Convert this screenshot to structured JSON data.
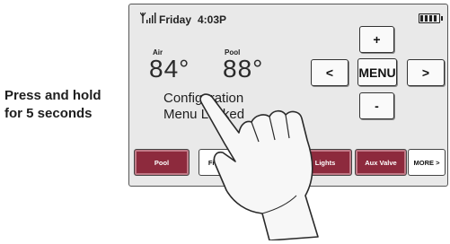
{
  "caption": {
    "line1": "Press and hold",
    "line2": "for 5 seconds"
  },
  "status": {
    "day": "Friday",
    "time": "4:03P",
    "signal_icon": "signal-icon",
    "battery_icon": "battery-icon"
  },
  "air": {
    "label": "Air",
    "value": "84°"
  },
  "pool": {
    "label": "Pool",
    "value": "88°"
  },
  "message": {
    "line1": "Configuration",
    "line2": "Menu Locked"
  },
  "nav": {
    "up": "+",
    "left": "<",
    "menu": "MENU",
    "right": ">",
    "down": "-"
  },
  "tabs": [
    {
      "label": "Pool"
    },
    {
      "label": "Filter"
    },
    {
      "label": "Lights"
    },
    {
      "label": "Aux Valve"
    },
    {
      "label": "MORE >"
    }
  ],
  "colors": {
    "tab_red": "#8d2a3d",
    "screen": "#e9e9e9"
  }
}
